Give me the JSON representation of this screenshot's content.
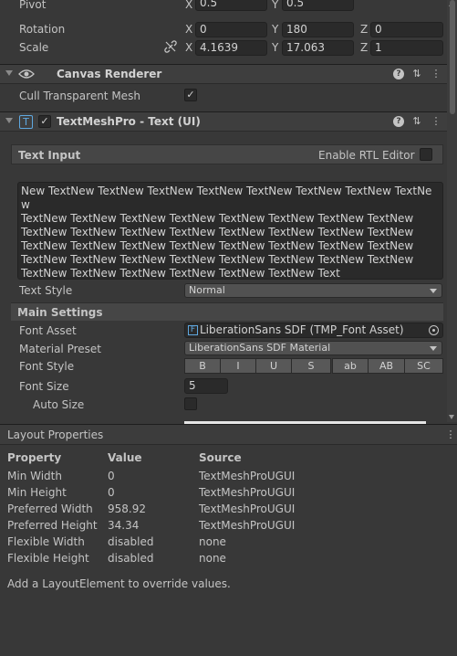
{
  "transform": {
    "pivot_label": "Pivot",
    "pivot": {
      "x_axis": "X",
      "x": "0.5",
      "y_axis": "Y",
      "y": "0.5"
    },
    "rotation_label": "Rotation",
    "rotation": {
      "x_axis": "X",
      "x": "0",
      "y_axis": "Y",
      "y": "180",
      "z_axis": "Z",
      "z": "0"
    },
    "scale_label": "Scale",
    "scale": {
      "x_axis": "X",
      "x": "4.1639",
      "y_axis": "Y",
      "y": "17.063",
      "z_axis": "Z",
      "z": "1"
    }
  },
  "canvas_renderer": {
    "title": "Canvas Renderer",
    "cull_label": "Cull Transparent Mesh",
    "cull_checked": true
  },
  "tmp": {
    "title": "TextMeshPro - Text (UI)",
    "text_input_label": "Text Input",
    "rtl_label": "Enable RTL Editor",
    "text_lines": [
      "New TextNew TextNew TextNew TextNew TextNew TextNew TextNew TextNew",
      "TextNew TextNew TextNew TextNew TextNew TextNew TextNew TextNew",
      "TextNew TextNew TextNew TextNew TextNew TextNew TextNew TextNew",
      "TextNew TextNew TextNew TextNew TextNew TextNew TextNew TextNew",
      "TextNew TextNew TextNew TextNew TextNew TextNew TextNew TextNew",
      "TextNew TextNew TextNew TextNew TextNew TextNew Text"
    ],
    "text_style_label": "Text Style",
    "text_style_value": "Normal",
    "main_settings_label": "Main Settings",
    "font_asset_label": "Font Asset",
    "font_asset_value": "LiberationSans SDF (TMP_Font Asset)",
    "material_preset_label": "Material Preset",
    "material_preset_value": "LiberationSans SDF Material",
    "font_style_label": "Font Style",
    "font_style_buttons": [
      "B",
      "I",
      "U",
      "S",
      "ab",
      "AB",
      "SC"
    ],
    "font_size_label": "Font Size",
    "font_size_value": "5",
    "auto_size_label": "Auto Size"
  },
  "layout_properties": {
    "title": "Layout Properties",
    "headers": {
      "property": "Property",
      "value": "Value",
      "source": "Source"
    },
    "rows": [
      {
        "property": "Min Width",
        "value": "0",
        "source": "TextMeshProUGUI"
      },
      {
        "property": "Min Height",
        "value": "0",
        "source": "TextMeshProUGUI"
      },
      {
        "property": "Preferred Width",
        "value": "958.92",
        "source": "TextMeshProUGUI"
      },
      {
        "property": "Preferred Height",
        "value": "34.34",
        "source": "TextMeshProUGUI"
      },
      {
        "property": "Flexible Width",
        "value": "disabled",
        "source": "none"
      },
      {
        "property": "Flexible Height",
        "value": "disabled",
        "source": "none"
      }
    ],
    "hint": "Add a LayoutElement to override values."
  },
  "icons": {
    "help": "help-icon",
    "presets": "presets-icon",
    "menu": "kebab-menu-icon",
    "eye": "eye-icon",
    "link": "constrain-proportions-icon",
    "tmp": "textmeshpro-icon",
    "font_asset": "font-asset-icon",
    "object_picker": "object-picker-icon"
  },
  "colors": {
    "background": "#383838",
    "field": "#2a2a2a",
    "header": "#3e3e3e"
  }
}
